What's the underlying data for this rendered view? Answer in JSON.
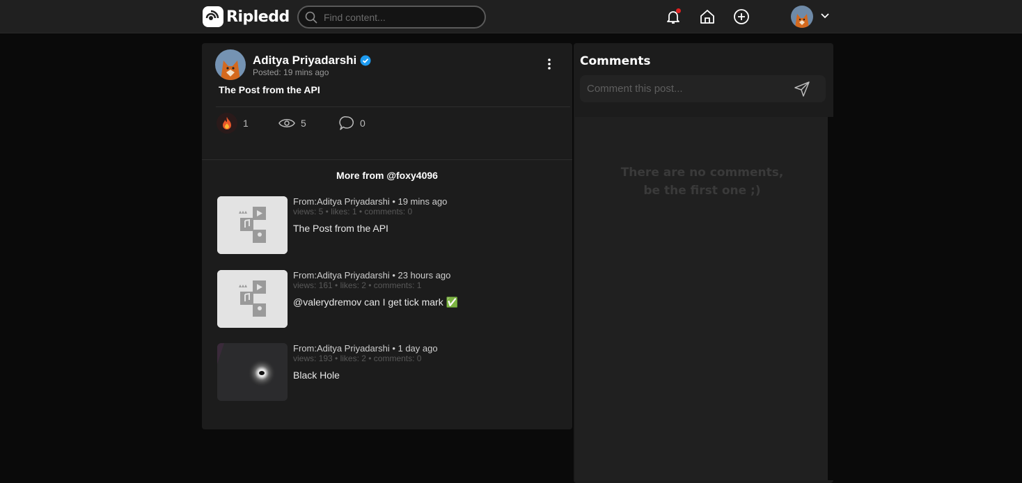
{
  "header": {
    "brand": "Ripledd",
    "search_placeholder": "Find content..."
  },
  "post": {
    "author": "Aditya Priyadarshi",
    "posted": "Posted: 19 mins ago",
    "title": "The Post from the API",
    "stats": {
      "likes": "1",
      "views": "5",
      "comments": "0"
    }
  },
  "more_from": {
    "heading": "More from @foxy4096",
    "items": [
      {
        "meta": "From:Aditya Priyadarshi • 19 mins ago",
        "stats": "views: 5 • likes: 1 • comments: 0",
        "title": "The Post from the API",
        "thumb": "placeholder"
      },
      {
        "meta": "From:Aditya Priyadarshi • 23 hours ago",
        "stats": "views: 161 • likes: 2 • comments: 1",
        "title": "@valerydremov can I get tick mark ✅",
        "thumb": "placeholder"
      },
      {
        "meta": "From:Aditya Priyadarshi • 1 day ago",
        "stats": "views: 193 • likes: 2 • comments: 0",
        "title": "Black Hole",
        "thumb": "black-hole"
      }
    ]
  },
  "comments": {
    "title": "Comments",
    "placeholder": "Comment this post...",
    "empty_line1": "There are no comments,",
    "empty_line2": "be the first one ;)"
  },
  "colors": {
    "background": "#0a0a0a",
    "card": "#1c1c1c",
    "verified": "#1d9bf0",
    "notification": "#e02020"
  }
}
